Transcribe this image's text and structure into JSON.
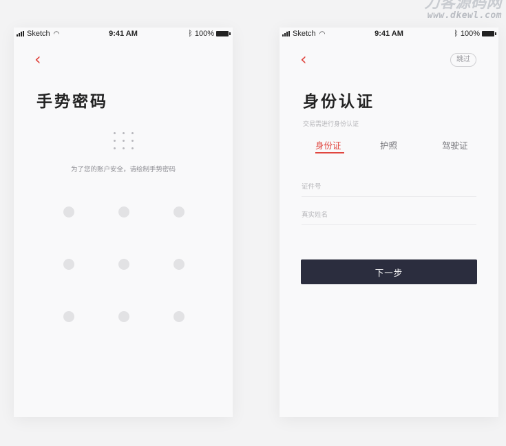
{
  "watermark": {
    "line1": "刀客源码网",
    "line2": "www.dkewl.com"
  },
  "status_bar": {
    "carrier": "Sketch",
    "time": "9:41 AM",
    "battery": "100%",
    "bluetooth": "bluetooth-icon"
  },
  "gesture_screen": {
    "back_icon": "‹",
    "title": "手势密码",
    "hint": "为了您的账户安全，请绘制手势密码",
    "pattern_dots": 9,
    "accent": "#e0463f"
  },
  "id_screen": {
    "back_icon": "‹",
    "skip_label": "跳过",
    "title": "身份认证",
    "subtitle": "交易需进行身份认证",
    "tabs": [
      {
        "label": "身份证",
        "active": true
      },
      {
        "label": "护照",
        "active": false
      },
      {
        "label": "驾驶证",
        "active": false
      }
    ],
    "fields": [
      {
        "placeholder": "证件号"
      },
      {
        "placeholder": "真实姓名"
      }
    ],
    "next_button": "下一步",
    "button_color": "#2b2d3e"
  }
}
